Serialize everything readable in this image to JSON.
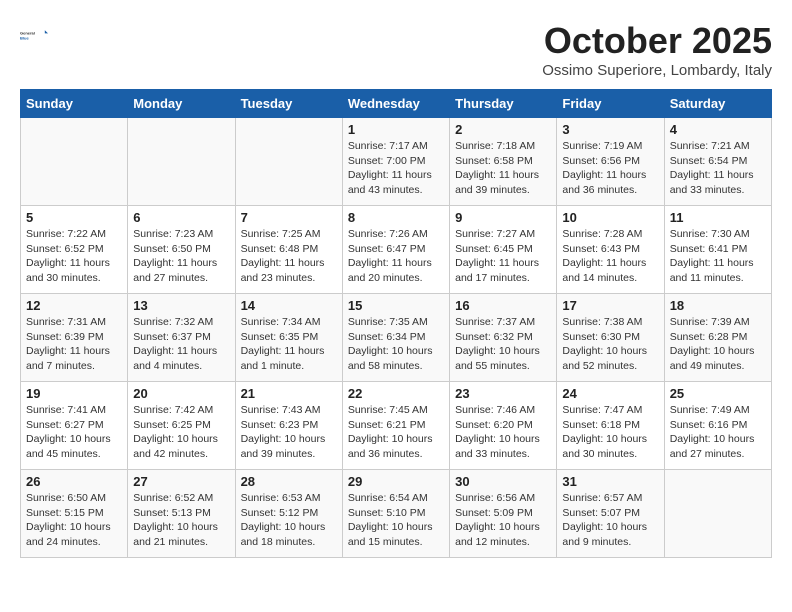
{
  "header": {
    "logo_general": "General",
    "logo_blue": "Blue",
    "month_title": "October 2025",
    "location": "Ossimo Superiore, Lombardy, Italy"
  },
  "days_of_week": [
    "Sunday",
    "Monday",
    "Tuesday",
    "Wednesday",
    "Thursday",
    "Friday",
    "Saturday"
  ],
  "weeks": [
    [
      {
        "day": "",
        "content": ""
      },
      {
        "day": "",
        "content": ""
      },
      {
        "day": "",
        "content": ""
      },
      {
        "day": "1",
        "content": "Sunrise: 7:17 AM\nSunset: 7:00 PM\nDaylight: 11 hours and 43 minutes."
      },
      {
        "day": "2",
        "content": "Sunrise: 7:18 AM\nSunset: 6:58 PM\nDaylight: 11 hours and 39 minutes."
      },
      {
        "day": "3",
        "content": "Sunrise: 7:19 AM\nSunset: 6:56 PM\nDaylight: 11 hours and 36 minutes."
      },
      {
        "day": "4",
        "content": "Sunrise: 7:21 AM\nSunset: 6:54 PM\nDaylight: 11 hours and 33 minutes."
      }
    ],
    [
      {
        "day": "5",
        "content": "Sunrise: 7:22 AM\nSunset: 6:52 PM\nDaylight: 11 hours and 30 minutes."
      },
      {
        "day": "6",
        "content": "Sunrise: 7:23 AM\nSunset: 6:50 PM\nDaylight: 11 hours and 27 minutes."
      },
      {
        "day": "7",
        "content": "Sunrise: 7:25 AM\nSunset: 6:48 PM\nDaylight: 11 hours and 23 minutes."
      },
      {
        "day": "8",
        "content": "Sunrise: 7:26 AM\nSunset: 6:47 PM\nDaylight: 11 hours and 20 minutes."
      },
      {
        "day": "9",
        "content": "Sunrise: 7:27 AM\nSunset: 6:45 PM\nDaylight: 11 hours and 17 minutes."
      },
      {
        "day": "10",
        "content": "Sunrise: 7:28 AM\nSunset: 6:43 PM\nDaylight: 11 hours and 14 minutes."
      },
      {
        "day": "11",
        "content": "Sunrise: 7:30 AM\nSunset: 6:41 PM\nDaylight: 11 hours and 11 minutes."
      }
    ],
    [
      {
        "day": "12",
        "content": "Sunrise: 7:31 AM\nSunset: 6:39 PM\nDaylight: 11 hours and 7 minutes."
      },
      {
        "day": "13",
        "content": "Sunrise: 7:32 AM\nSunset: 6:37 PM\nDaylight: 11 hours and 4 minutes."
      },
      {
        "day": "14",
        "content": "Sunrise: 7:34 AM\nSunset: 6:35 PM\nDaylight: 11 hours and 1 minute."
      },
      {
        "day": "15",
        "content": "Sunrise: 7:35 AM\nSunset: 6:34 PM\nDaylight: 10 hours and 58 minutes."
      },
      {
        "day": "16",
        "content": "Sunrise: 7:37 AM\nSunset: 6:32 PM\nDaylight: 10 hours and 55 minutes."
      },
      {
        "day": "17",
        "content": "Sunrise: 7:38 AM\nSunset: 6:30 PM\nDaylight: 10 hours and 52 minutes."
      },
      {
        "day": "18",
        "content": "Sunrise: 7:39 AM\nSunset: 6:28 PM\nDaylight: 10 hours and 49 minutes."
      }
    ],
    [
      {
        "day": "19",
        "content": "Sunrise: 7:41 AM\nSunset: 6:27 PM\nDaylight: 10 hours and 45 minutes."
      },
      {
        "day": "20",
        "content": "Sunrise: 7:42 AM\nSunset: 6:25 PM\nDaylight: 10 hours and 42 minutes."
      },
      {
        "day": "21",
        "content": "Sunrise: 7:43 AM\nSunset: 6:23 PM\nDaylight: 10 hours and 39 minutes."
      },
      {
        "day": "22",
        "content": "Sunrise: 7:45 AM\nSunset: 6:21 PM\nDaylight: 10 hours and 36 minutes."
      },
      {
        "day": "23",
        "content": "Sunrise: 7:46 AM\nSunset: 6:20 PM\nDaylight: 10 hours and 33 minutes."
      },
      {
        "day": "24",
        "content": "Sunrise: 7:47 AM\nSunset: 6:18 PM\nDaylight: 10 hours and 30 minutes."
      },
      {
        "day": "25",
        "content": "Sunrise: 7:49 AM\nSunset: 6:16 PM\nDaylight: 10 hours and 27 minutes."
      }
    ],
    [
      {
        "day": "26",
        "content": "Sunrise: 6:50 AM\nSunset: 5:15 PM\nDaylight: 10 hours and 24 minutes."
      },
      {
        "day": "27",
        "content": "Sunrise: 6:52 AM\nSunset: 5:13 PM\nDaylight: 10 hours and 21 minutes."
      },
      {
        "day": "28",
        "content": "Sunrise: 6:53 AM\nSunset: 5:12 PM\nDaylight: 10 hours and 18 minutes."
      },
      {
        "day": "29",
        "content": "Sunrise: 6:54 AM\nSunset: 5:10 PM\nDaylight: 10 hours and 15 minutes."
      },
      {
        "day": "30",
        "content": "Sunrise: 6:56 AM\nSunset: 5:09 PM\nDaylight: 10 hours and 12 minutes."
      },
      {
        "day": "31",
        "content": "Sunrise: 6:57 AM\nSunset: 5:07 PM\nDaylight: 10 hours and 9 minutes."
      },
      {
        "day": "",
        "content": ""
      }
    ]
  ]
}
